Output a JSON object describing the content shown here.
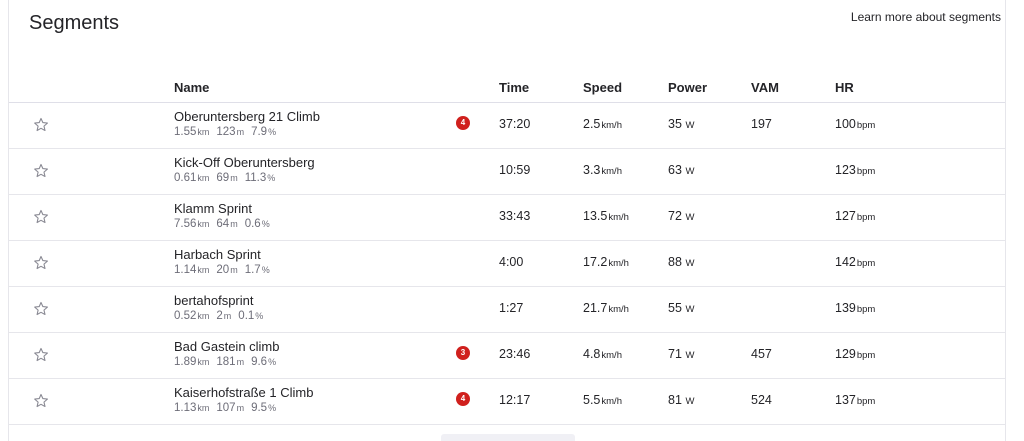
{
  "page": {
    "title": "Segments",
    "learn_more": "Learn more about segments"
  },
  "columns": {
    "name": "Name",
    "time": "Time",
    "speed": "Speed",
    "power": "Power",
    "vam": "VAM",
    "hr": "HR"
  },
  "units": {
    "distance": "km",
    "elevation": "m",
    "grade": "%",
    "speed": "km/h",
    "power": "W",
    "hr": "bpm"
  },
  "segments": [
    {
      "name": "Oberuntersberg 21 Climb",
      "distance": "1.55",
      "elevation": "123",
      "grade": "7.9",
      "badge": "4",
      "time": "37:20",
      "speed": "2.5",
      "power": "35",
      "vam": "197",
      "hr": "100"
    },
    {
      "name": "Kick-Off Oberuntersberg",
      "distance": "0.61",
      "elevation": "69",
      "grade": "11.3",
      "badge": "",
      "time": "10:59",
      "speed": "3.3",
      "power": "63",
      "vam": "",
      "hr": "123"
    },
    {
      "name": "Klamm Sprint",
      "distance": "7.56",
      "elevation": "64",
      "grade": "0.6",
      "badge": "",
      "time": "33:43",
      "speed": "13.5",
      "power": "72",
      "vam": "",
      "hr": "127"
    },
    {
      "name": "Harbach Sprint",
      "distance": "1.14",
      "elevation": "20",
      "grade": "1.7",
      "badge": "",
      "time": "4:00",
      "speed": "17.2",
      "power": "88",
      "vam": "",
      "hr": "142"
    },
    {
      "name": "bertahofsprint",
      "distance": "0.52",
      "elevation": "2",
      "grade": "0.1",
      "badge": "",
      "time": "1:27",
      "speed": "21.7",
      "power": "55",
      "vam": "",
      "hr": "139"
    },
    {
      "name": "Bad Gastein climb",
      "distance": "1.89",
      "elevation": "181",
      "grade": "9.6",
      "badge": "3",
      "time": "23:46",
      "speed": "4.8",
      "power": "71",
      "vam": "457",
      "hr": "129"
    },
    {
      "name": "Kaiserhofstraße 1 Climb",
      "distance": "1.13",
      "elevation": "107",
      "grade": "9.5",
      "badge": "4",
      "time": "12:17",
      "speed": "5.5",
      "power": "81",
      "vam": "524",
      "hr": "137"
    }
  ],
  "colors": {
    "badge": "#d0201d",
    "text": "#242428",
    "muted": "#6d6d78",
    "divider": "#e6e6eb"
  }
}
